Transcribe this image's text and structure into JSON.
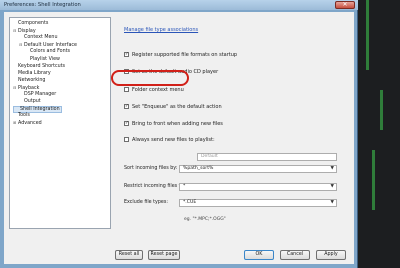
{
  "window": {
    "title": "Preferences: Shell Integration",
    "close_glyph": "✕"
  },
  "tree": [
    {
      "label": "Components",
      "toggle": "",
      "indent": 0,
      "selected": false
    },
    {
      "label": "Display",
      "toggle": "⊟",
      "indent": 0,
      "selected": false
    },
    {
      "label": "Context Menu",
      "toggle": "",
      "indent": 1,
      "selected": false
    },
    {
      "label": "Default User Interface",
      "toggle": "⊟",
      "indent": 1,
      "selected": false
    },
    {
      "label": "Colors and Fonts",
      "toggle": "",
      "indent": 2,
      "selected": false
    },
    {
      "label": "Playlist View",
      "toggle": "",
      "indent": 2,
      "selected": false
    },
    {
      "label": "Keyboard Shortcuts",
      "toggle": "",
      "indent": 0,
      "selected": false
    },
    {
      "label": "Media Library",
      "toggle": "",
      "indent": 0,
      "selected": false
    },
    {
      "label": "Networking",
      "toggle": "",
      "indent": 0,
      "selected": false
    },
    {
      "label": "Playback",
      "toggle": "⊟",
      "indent": 0,
      "selected": false
    },
    {
      "label": "DSP Manager",
      "toggle": "",
      "indent": 1,
      "selected": false
    },
    {
      "label": "Output",
      "toggle": "",
      "indent": 1,
      "selected": false
    },
    {
      "label": "Shell Integration",
      "toggle": "",
      "indent": 0,
      "selected": true
    },
    {
      "label": "Tools",
      "toggle": "",
      "indent": 0,
      "selected": false
    },
    {
      "label": "Advanced",
      "toggle": "⊞",
      "indent": 0,
      "selected": false
    }
  ],
  "panel": {
    "link": "Manage file type associations",
    "checkboxes": [
      {
        "label": "Register supported file formats on startup",
        "checked": true
      },
      {
        "label": "Set as the default audio CD player",
        "checked": false
      },
      {
        "label": "Folder context menu",
        "checked": false
      },
      {
        "label": "Set \"Enqueue\" as the default action",
        "checked": true
      },
      {
        "label": "Bring to front when adding new files",
        "checked": true
      },
      {
        "label": "Always send new files to playlist:",
        "checked": false
      }
    ],
    "playlist_placeholder": "Default",
    "sort_label": "Sort incoming files by:",
    "sort_value": "%path_sort%",
    "restrict_label": "Restrict incoming files to:",
    "restrict_value": "*",
    "exclude_label": "Exclude file types:",
    "exclude_value": "*.CUE",
    "exclude_hint": "eg. \"*.MPC;*.OGG\"",
    "check_glyph": "✓",
    "dropdown_glyph": "▼"
  },
  "buttons": {
    "reset_all": "Reset all",
    "reset_page": "Reset page",
    "ok": "OK",
    "cancel": "Cancel",
    "apply": "Apply"
  },
  "colors": {
    "highlight_ring": "#d12018",
    "link": "#2a55b8",
    "selection": "#d9e7f5"
  }
}
